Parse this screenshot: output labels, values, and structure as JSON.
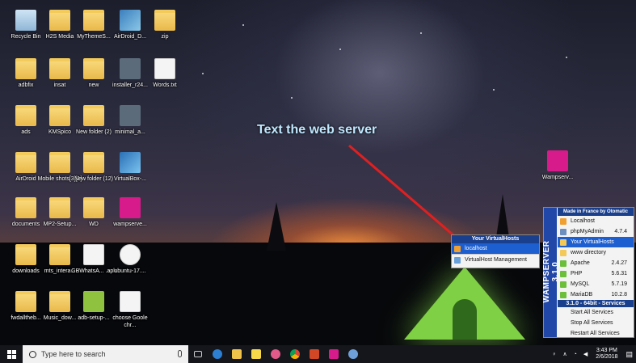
{
  "desktop": {
    "icons": [
      {
        "label": "Recycle Bin",
        "icon": "recycle-bin-icon"
      },
      {
        "label": "H2S Media",
        "icon": "folder-icon"
      },
      {
        "label": "MyThemeS...",
        "icon": "folder-icon"
      },
      {
        "label": "AirDroid_D...",
        "icon": "app-icon"
      },
      {
        "label": "zip",
        "icon": "folder-icon"
      },
      {
        "label": "adbfix",
        "icon": "folder-icon"
      },
      {
        "label": "insat",
        "icon": "folder-icon"
      },
      {
        "label": "new",
        "icon": "folder-icon"
      },
      {
        "label": "installer_r24...",
        "icon": "installer-icon"
      },
      {
        "label": "Words.txt",
        "icon": "text-file-icon"
      },
      {
        "label": "ads",
        "icon": "folder-icon"
      },
      {
        "label": "KMSpico",
        "icon": "folder-icon"
      },
      {
        "label": "New folder (2)",
        "icon": "folder-icon"
      },
      {
        "label": "minimal_a...",
        "icon": "setup-icon"
      },
      {
        "label": "AirDroid",
        "icon": "folder-icon"
      },
      {
        "label": "Mobile shots[3][1]",
        "icon": "folder-icon"
      },
      {
        "label": "New folder (12)",
        "icon": "folder-icon"
      },
      {
        "label": "VirtualBox-...",
        "icon": "virtualbox-icon"
      },
      {
        "label": "documents",
        "icon": "folder-icon"
      },
      {
        "label": "MP2-Setup...",
        "icon": "folder-icon"
      },
      {
        "label": "WD",
        "icon": "folder-icon"
      },
      {
        "label": "wampserve...",
        "icon": "wamp-icon"
      },
      {
        "label": "downloads",
        "icon": "folder-icon"
      },
      {
        "label": "mts_intera...",
        "icon": "folder-icon"
      },
      {
        "label": "GBWhatsA... .apk",
        "icon": "file-icon"
      },
      {
        "label": "ubuntu-17....",
        "icon": "disc-icon"
      },
      {
        "label": "fwdalltheb...",
        "icon": "folder-icon"
      },
      {
        "label": "Music_dow...",
        "icon": "folder-icon"
      },
      {
        "label": "adb-setup-...",
        "icon": "android-icon"
      },
      {
        "label": "choose Goole chr...",
        "icon": "image-icon"
      },
      {
        "label": "Wampserv...",
        "icon": "wamp-icon"
      }
    ]
  },
  "annotation": {
    "text": "Text the web server"
  },
  "virtualhosts_menu": {
    "header": "Your VirtualHosts",
    "items": [
      {
        "label": "localhost",
        "icon": "home-icon",
        "selected": true
      },
      {
        "label": "VirtualHost Management",
        "icon": "edit-icon",
        "selected": false
      }
    ]
  },
  "wamp_menu": {
    "side_label": "WAMPSERVER 3.1.0",
    "header": "Made in France by Otomatic",
    "items": [
      {
        "label": "Localhost",
        "icon": "home-icon",
        "version": "",
        "selected": false
      },
      {
        "label": "phpMyAdmin",
        "icon": "db-icon",
        "version": "4.7.4",
        "selected": false
      },
      {
        "label": "Your VirtualHosts",
        "icon": "folder-icon",
        "version": "",
        "selected": true
      },
      {
        "label": "www directory",
        "icon": "folder-icon",
        "version": "",
        "selected": false
      },
      {
        "label": "Apache",
        "icon": "apache-icon",
        "version": "2.4.27",
        "selected": false
      },
      {
        "label": "PHP",
        "icon": "php-icon",
        "version": "5.6.31",
        "selected": false
      },
      {
        "label": "MySQL",
        "icon": "mysql-icon",
        "version": "5.7.19",
        "selected": false
      },
      {
        "label": "MariaDB",
        "icon": "mariadb-icon",
        "version": "10.2.8",
        "selected": false
      }
    ],
    "subheader": "3.1.0 - 64bit - Services",
    "services": [
      {
        "label": "Start All Services"
      },
      {
        "label": "Stop All Services"
      },
      {
        "label": "Restart All Services"
      }
    ]
  },
  "taskbar": {
    "search_placeholder": "Type here to search",
    "time": "3:43 PM",
    "date": "2/6/2018"
  },
  "colors": {
    "menu_header": "#1a3f8c",
    "selection": "#1d5fd0",
    "annotation_text": "#bfe8ff",
    "arrow": "#e02020"
  }
}
